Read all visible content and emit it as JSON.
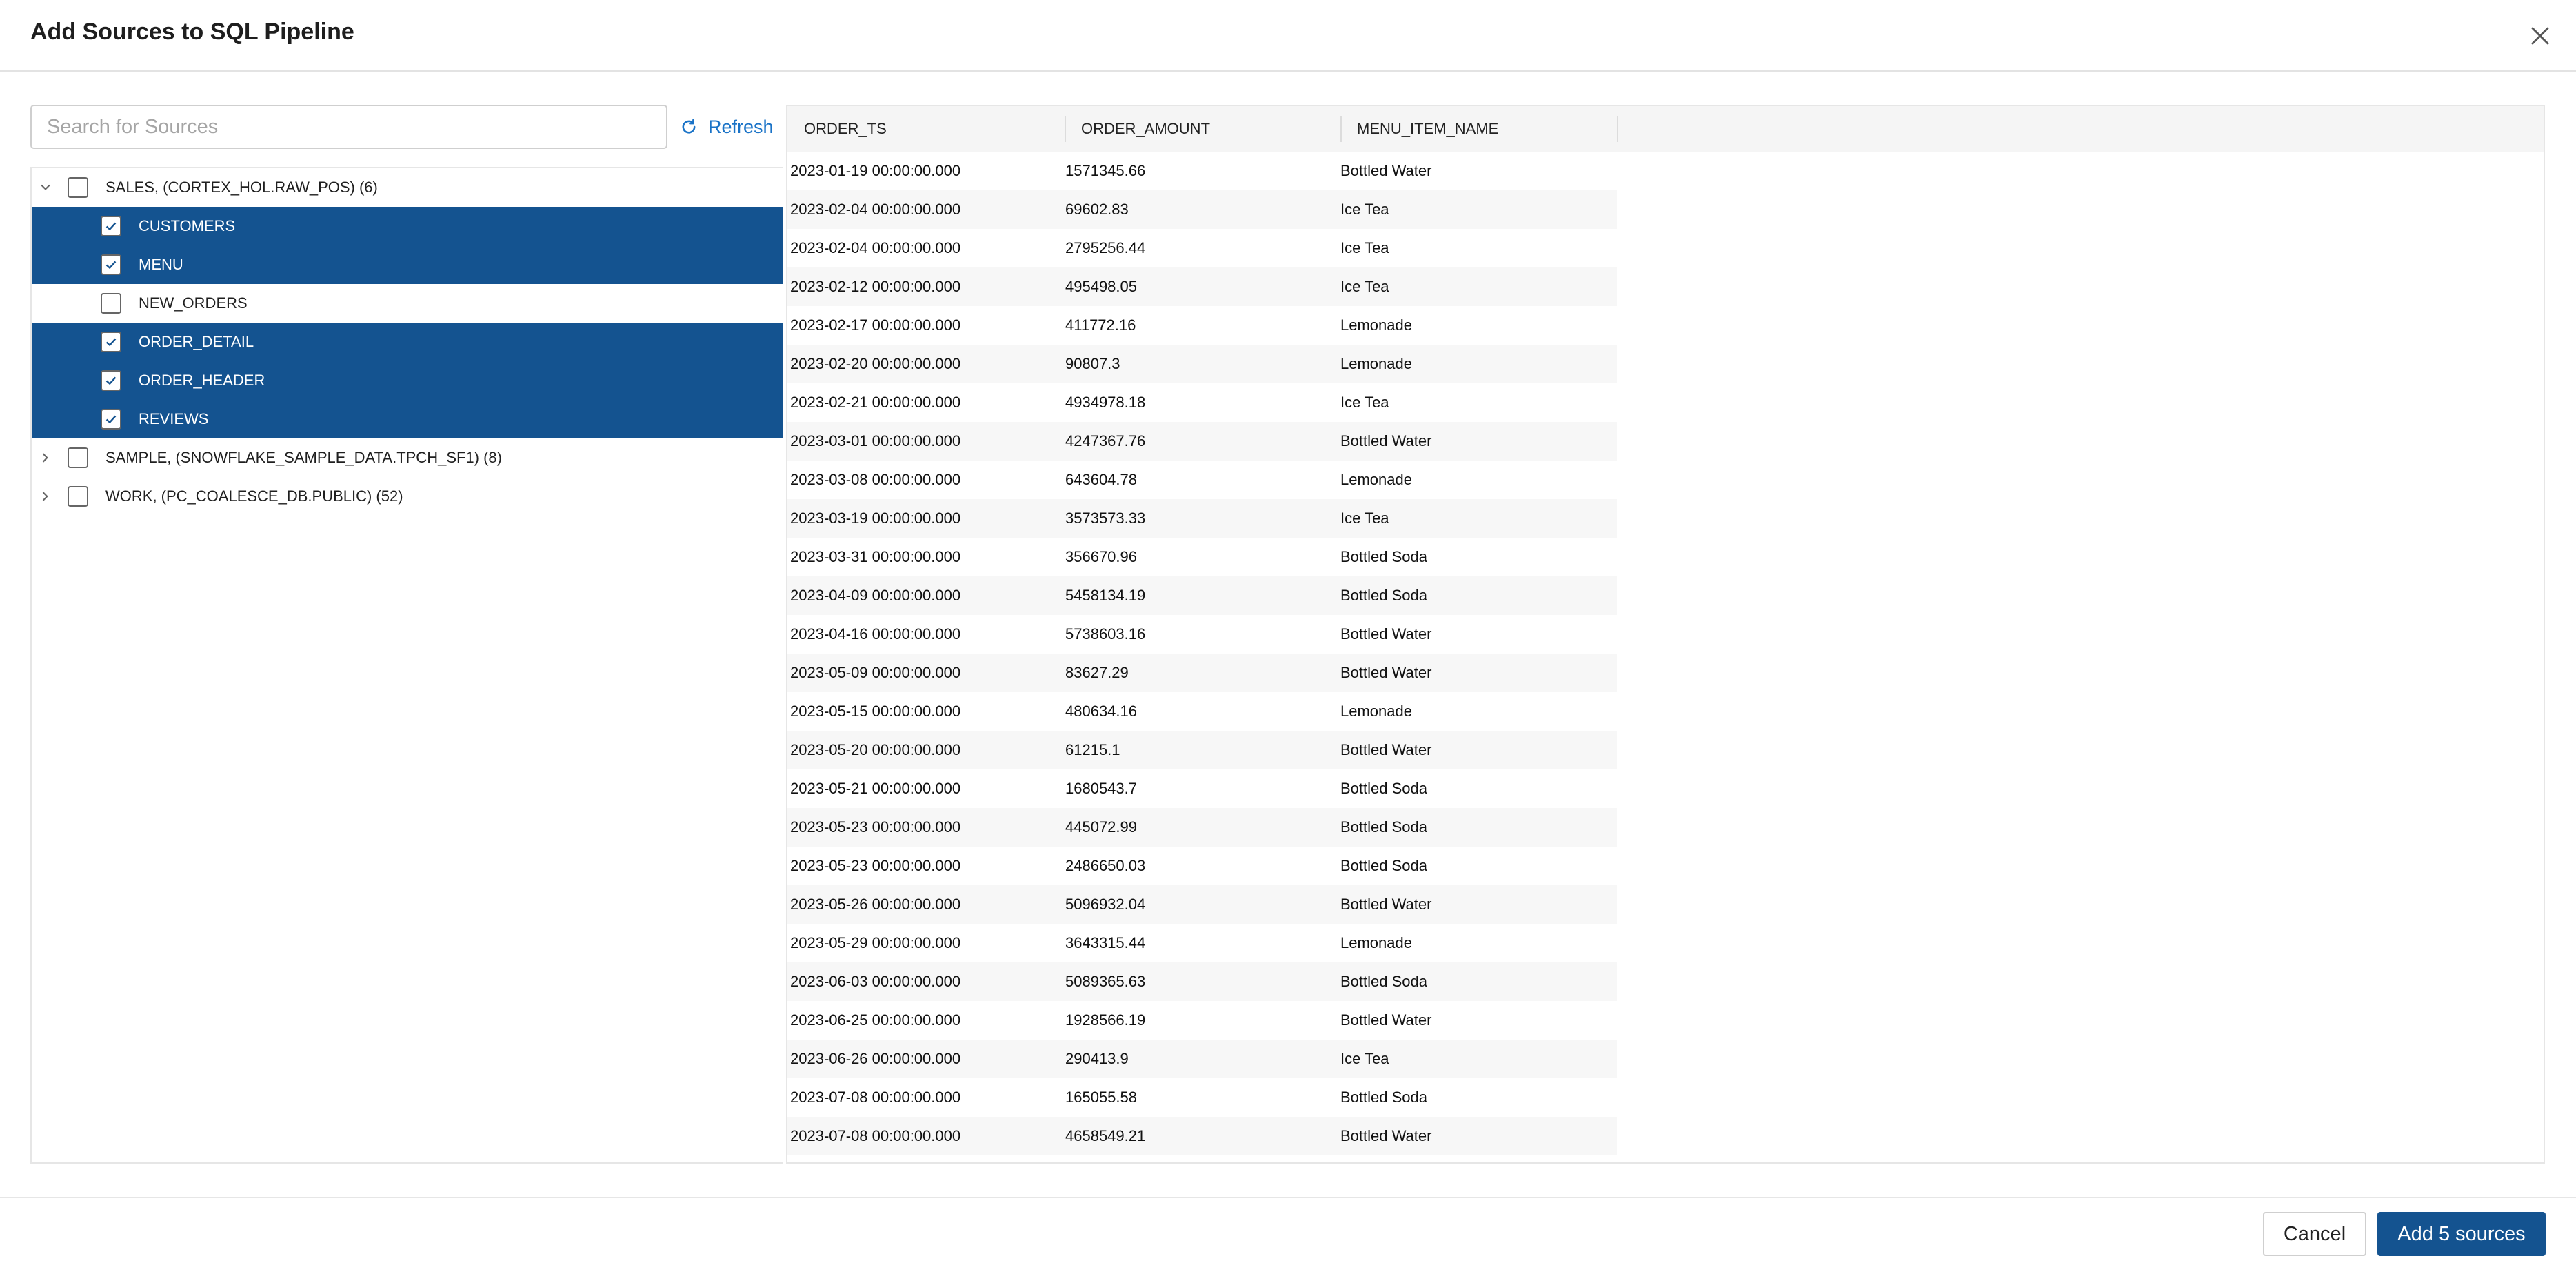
{
  "dialog": {
    "title": "Add Sources to SQL Pipeline"
  },
  "icons": {
    "close": "close-icon",
    "refresh": "refresh-icon",
    "expand": "chevron-right-icon",
    "collapse": "chevron-down-icon",
    "check": "checkmark-icon"
  },
  "colors": {
    "accent": "#145390",
    "link": "#1a73c7",
    "selected_row_text": "#ffffff"
  },
  "search": {
    "placeholder": "Search for Sources",
    "value": ""
  },
  "refresh_label": "Refresh",
  "tree": {
    "groups": [
      {
        "label": "SALES, (CORTEX_HOL.RAW_POS) (6)",
        "expanded": true,
        "checked": false,
        "children": [
          {
            "label": "CUSTOMERS",
            "checked": true
          },
          {
            "label": "MENU",
            "checked": true
          },
          {
            "label": "NEW_ORDERS",
            "checked": false
          },
          {
            "label": "ORDER_DETAIL",
            "checked": true
          },
          {
            "label": "ORDER_HEADER",
            "checked": true
          },
          {
            "label": "REVIEWS",
            "checked": true
          }
        ]
      },
      {
        "label": "SAMPLE, (SNOWFLAKE_SAMPLE_DATA.TPCH_SF1) (8)",
        "expanded": false,
        "checked": false
      },
      {
        "label": "WORK, (PC_COALESCE_DB.PUBLIC) (52)",
        "expanded": false,
        "checked": false
      }
    ]
  },
  "grid": {
    "columns": [
      "ORDER_TS",
      "ORDER_AMOUNT",
      "MENU_ITEM_NAME"
    ],
    "rows": [
      [
        "2023-01-19 00:00:00.000",
        "1571345.66",
        "Bottled Water"
      ],
      [
        "2023-02-04 00:00:00.000",
        "69602.83",
        "Ice Tea"
      ],
      [
        "2023-02-04 00:00:00.000",
        "2795256.44",
        "Ice Tea"
      ],
      [
        "2023-02-12 00:00:00.000",
        "495498.05",
        "Ice Tea"
      ],
      [
        "2023-02-17 00:00:00.000",
        "411772.16",
        "Lemonade"
      ],
      [
        "2023-02-20 00:00:00.000",
        "90807.3",
        "Lemonade"
      ],
      [
        "2023-02-21 00:00:00.000",
        "4934978.18",
        "Ice Tea"
      ],
      [
        "2023-03-01 00:00:00.000",
        "4247367.76",
        "Bottled Water"
      ],
      [
        "2023-03-08 00:00:00.000",
        "643604.78",
        "Lemonade"
      ],
      [
        "2023-03-19 00:00:00.000",
        "3573573.33",
        "Ice Tea"
      ],
      [
        "2023-03-31 00:00:00.000",
        "356670.96",
        "Bottled Soda"
      ],
      [
        "2023-04-09 00:00:00.000",
        "5458134.19",
        "Bottled Soda"
      ],
      [
        "2023-04-16 00:00:00.000",
        "5738603.16",
        "Bottled Water"
      ],
      [
        "2023-05-09 00:00:00.000",
        "83627.29",
        "Bottled Water"
      ],
      [
        "2023-05-15 00:00:00.000",
        "480634.16",
        "Lemonade"
      ],
      [
        "2023-05-20 00:00:00.000",
        "61215.1",
        "Bottled Water"
      ],
      [
        "2023-05-21 00:00:00.000",
        "1680543.7",
        "Bottled Soda"
      ],
      [
        "2023-05-23 00:00:00.000",
        "445072.99",
        "Bottled Soda"
      ],
      [
        "2023-05-23 00:00:00.000",
        "2486650.03",
        "Bottled Soda"
      ],
      [
        "2023-05-26 00:00:00.000",
        "5096932.04",
        "Bottled Water"
      ],
      [
        "2023-05-29 00:00:00.000",
        "3643315.44",
        "Lemonade"
      ],
      [
        "2023-06-03 00:00:00.000",
        "5089365.63",
        "Bottled Soda"
      ],
      [
        "2023-06-25 00:00:00.000",
        "1928566.19",
        "Bottled Water"
      ],
      [
        "2023-06-26 00:00:00.000",
        "290413.9",
        "Ice Tea"
      ],
      [
        "2023-07-08 00:00:00.000",
        "165055.58",
        "Bottled Soda"
      ],
      [
        "2023-07-08 00:00:00.000",
        "4658549.21",
        "Bottled Water"
      ]
    ]
  },
  "footer": {
    "cancel_label": "Cancel",
    "add_label": "Add 5 sources"
  }
}
